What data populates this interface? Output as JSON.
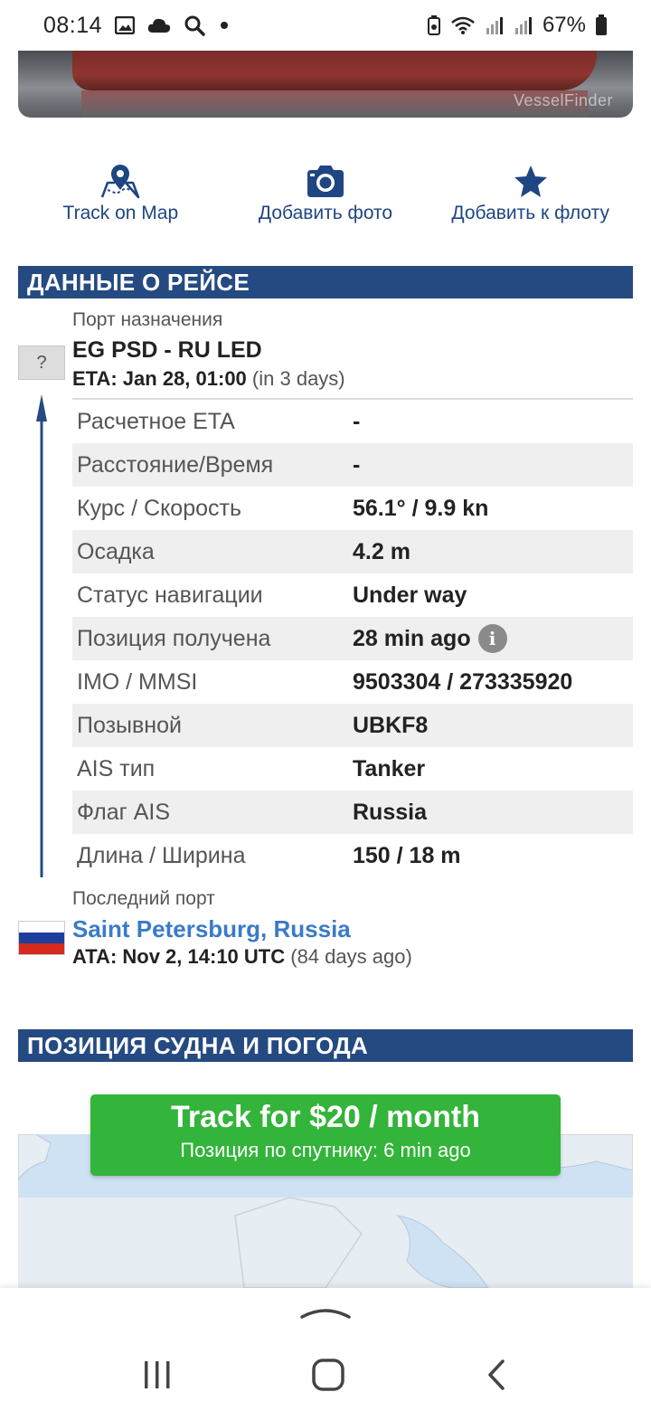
{
  "status_bar": {
    "time": "08:14",
    "battery": "67%",
    "icons": [
      "gallery-icon",
      "cloud-icon",
      "search-icon",
      "dot-icon",
      "battery-saver-icon",
      "wifi-icon",
      "signal-icon",
      "signal-icon-2",
      "battery-icon"
    ]
  },
  "photo": {
    "watermark": "VesselFinder"
  },
  "actions": {
    "track_on_map": "Track on Map",
    "add_photo": "Добавить фото",
    "add_to_fleet": "Добавить к флоту"
  },
  "voyage": {
    "header": "ДАННЫЕ О РЕЙСЕ",
    "dest_label": "Порт назначения",
    "unknown_flag": "?",
    "route": "EG PSD - RU LED",
    "eta": "ETA: Jan 28, 01:00",
    "eta_rel": "(in 3 days)",
    "rows": [
      {
        "key": "Расчетное ETA",
        "value": "-"
      },
      {
        "key": "Расстояние/Время",
        "value": "-"
      },
      {
        "key": "Курс / Скорость",
        "value": "56.1° / 9.9 kn"
      },
      {
        "key": "Осадка",
        "value": "4.2 m"
      },
      {
        "key": "Статус навигации",
        "value": "Under way"
      },
      {
        "key": "Позиция получена",
        "value": "28 min ago"
      },
      {
        "key": "IMO / MMSI",
        "value": "9503304 / 273335920"
      },
      {
        "key": "Позывной",
        "value": "UBKF8"
      },
      {
        "key": "AIS тип",
        "value": "Tanker"
      },
      {
        "key": "Флаг AIS",
        "value": "Russia"
      },
      {
        "key": "Длина / Ширина",
        "value": "150 / 18 m"
      }
    ],
    "info_glyph": "i",
    "last_label": "Последний порт",
    "last_port": "Saint Petersburg, Russia",
    "ata": "ATA: Nov 2, 14:10 UTC",
    "ata_rel": "(84 days ago)"
  },
  "position": {
    "header": "ПОЗИЦИЯ СУДНА И ПОГОДА",
    "cta_main": "Track for $20 / month",
    "cta_sub": "Позиция по спутнику: 6 min ago"
  },
  "colors": {
    "header_bg": "#254a82",
    "accent_blue": "#1e4682",
    "link_blue": "#3a7bc8",
    "cta_green": "#33b43a"
  }
}
